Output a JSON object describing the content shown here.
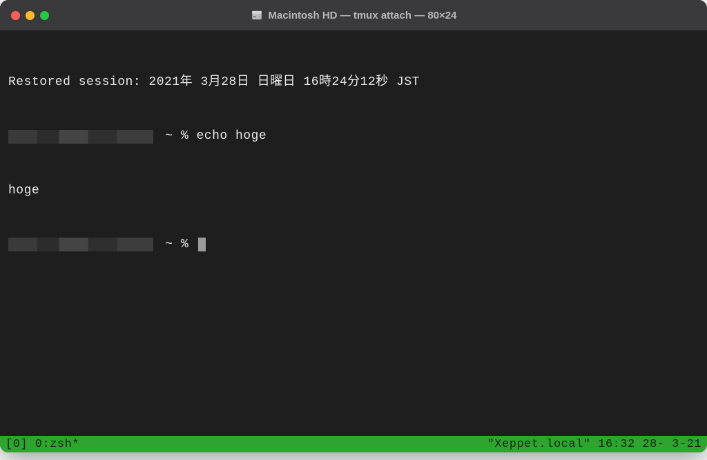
{
  "window": {
    "title": "Macintosh HD — tmux attach — 80×24"
  },
  "terminal": {
    "restored_line": "Restored session: 2021年 3月28日 日曜日 16時24分12秒 JST",
    "prompt1_suffix": " ~ % echo hoge",
    "output1": "hoge",
    "prompt2_suffix": " ~ % "
  },
  "statusbar": {
    "left": "[0] 0:zsh*",
    "right": "\"Xeppet.local\" 16:32 28- 3-21"
  }
}
